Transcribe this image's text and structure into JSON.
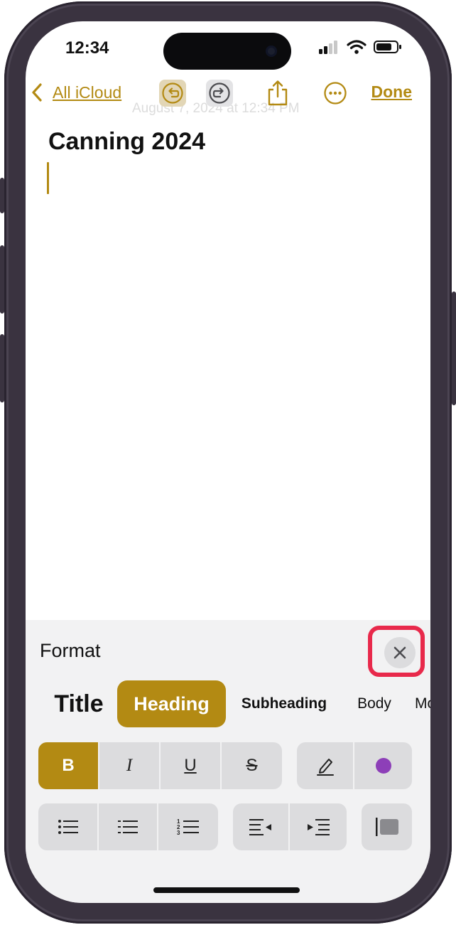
{
  "status": {
    "time": "12:34"
  },
  "nav": {
    "back_label": "All iCloud",
    "done_label": "Done"
  },
  "ghost_date": "August 7, 2024 at 12:34 PM",
  "note": {
    "title": "Canning 2024"
  },
  "format": {
    "label": "Format",
    "styles": [
      "Title",
      "Heading",
      "Subheading",
      "Body",
      "Mo"
    ],
    "active_style": "Heading",
    "text_styles": [
      "B",
      "I",
      "U",
      "S"
    ]
  },
  "colors": {
    "accent": "#b38a13",
    "highlight": "#e8294b",
    "purple_dot": "#8d3fb8"
  },
  "icons": [
    "chevron-left-icon",
    "undo-icon",
    "redo-icon",
    "share-icon",
    "more-icon",
    "close-icon",
    "pencil-icon",
    "color-dot-icon",
    "bullet-list-icon",
    "dash-list-icon",
    "numbered-list-icon",
    "outdent-icon",
    "indent-icon",
    "block-quote-icon",
    "wifi-icon",
    "signal-icon",
    "battery-icon"
  ]
}
